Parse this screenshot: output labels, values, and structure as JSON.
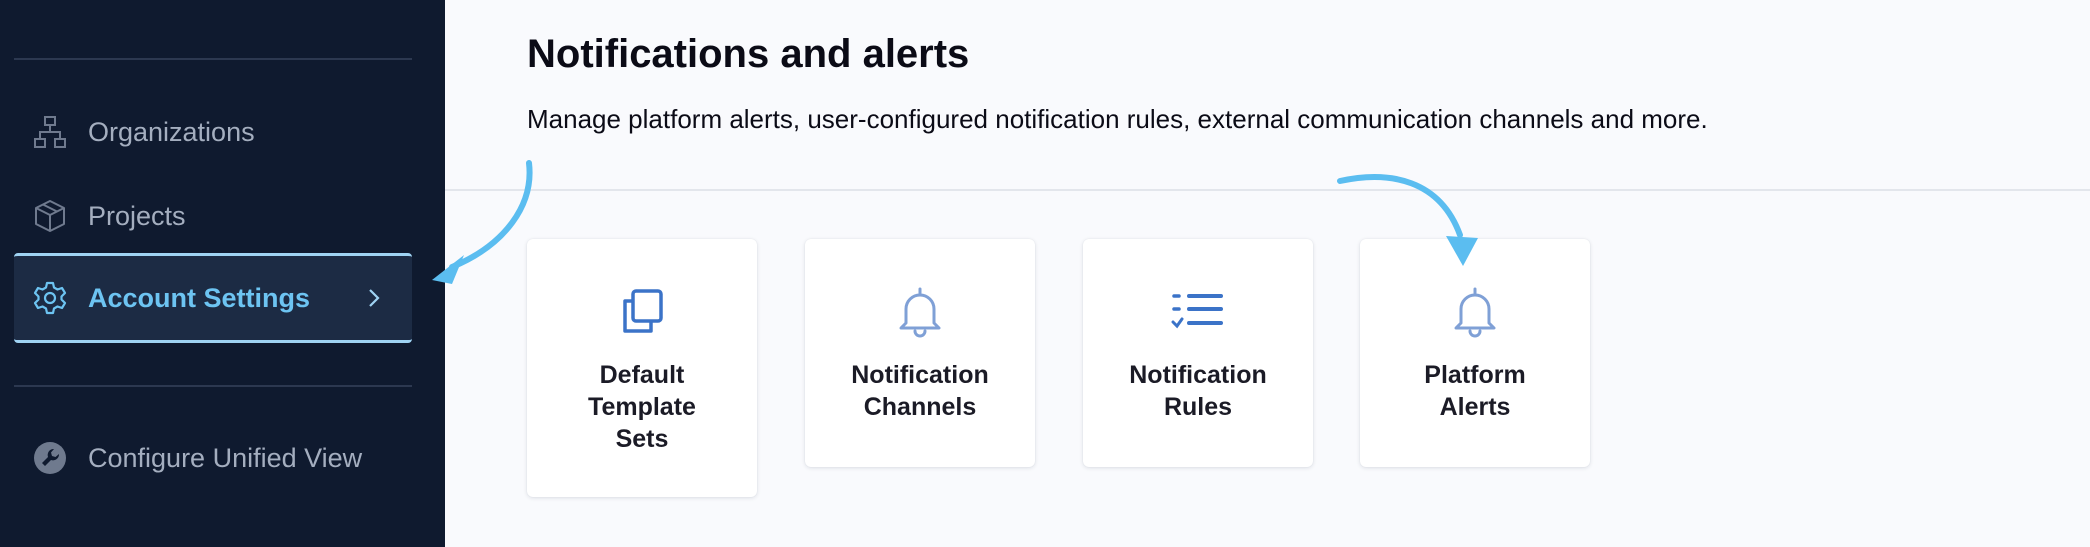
{
  "sidebar": {
    "items": [
      {
        "label": "Organizations",
        "icon": "organizations-icon"
      },
      {
        "label": "Projects",
        "icon": "cube-icon"
      },
      {
        "label": "Account Settings",
        "icon": "gear-icon",
        "active": true
      },
      {
        "label": "Configure Unified View",
        "icon": "wrench-icon"
      }
    ]
  },
  "main": {
    "title": "Notifications and alerts",
    "subtitle": "Manage platform alerts, user-configured notification rules, external communication channels and more.",
    "cards": [
      {
        "label": "Default Template Sets",
        "icon": "copy-icon"
      },
      {
        "label": "Notification Channels",
        "icon": "bell-icon"
      },
      {
        "label": "Notification Rules",
        "icon": "checklist-icon"
      },
      {
        "label": "Platform Alerts",
        "icon": "bell-icon"
      }
    ]
  },
  "colors": {
    "sidebar_bg": "#0f1a2f",
    "accent": "#6dc4f2",
    "annotation_arrow": "#5bbdf0",
    "card_icon": "#3b73c8"
  }
}
